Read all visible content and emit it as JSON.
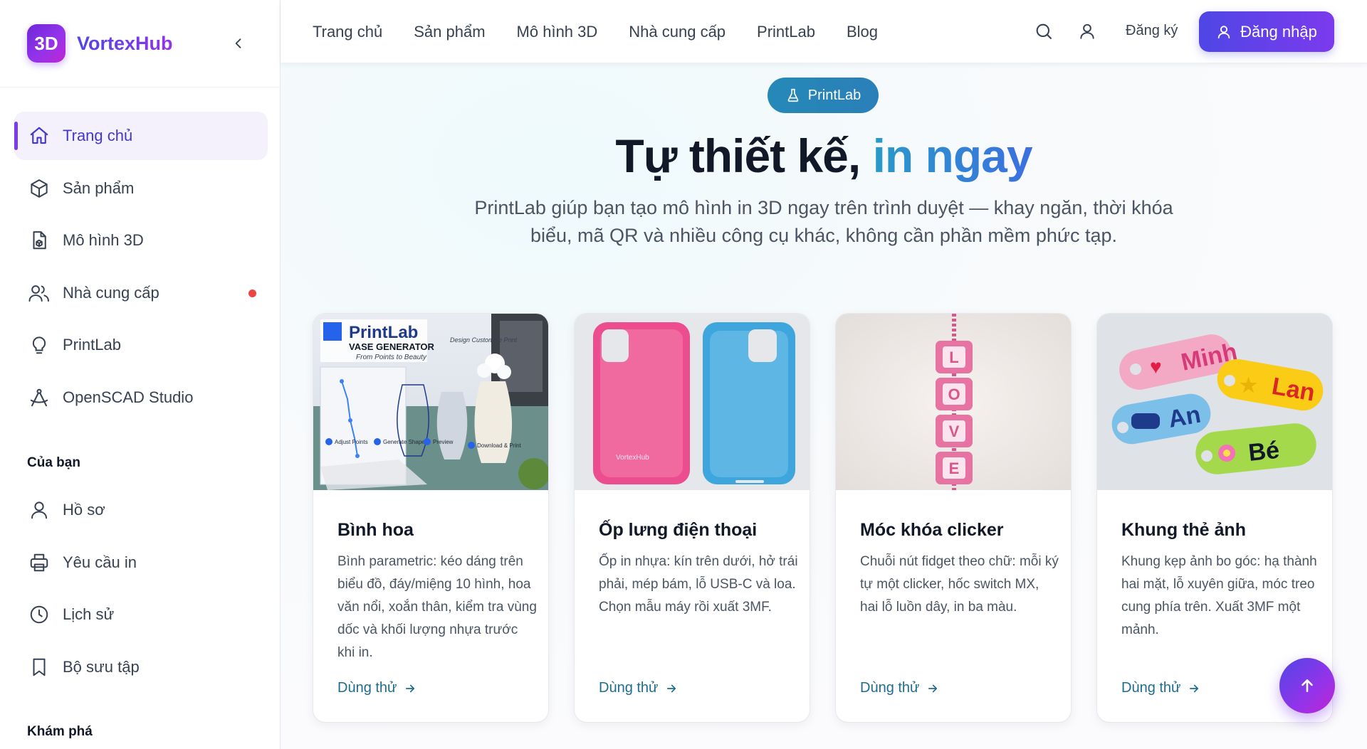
{
  "brand": {
    "logo_text": "3D",
    "name": "VortexHub"
  },
  "sidebar": {
    "items": [
      {
        "label": "Trang chủ",
        "icon": "home-icon",
        "active": true
      },
      {
        "label": "Sản phẩm",
        "icon": "cube-icon"
      },
      {
        "label": "Mô hình 3D",
        "icon": "model-file-icon"
      },
      {
        "label": "Nhà cung cấp",
        "icon": "users-icon",
        "badge": "red-dot"
      },
      {
        "label": "PrintLab",
        "icon": "lightbulb-icon"
      },
      {
        "label": "OpenSCAD Studio",
        "icon": "compass-icon"
      }
    ],
    "section_yours": "Của bạn",
    "yours_items": [
      {
        "label": "Hồ sơ",
        "icon": "user-icon"
      },
      {
        "label": "Yêu cầu in",
        "icon": "printer-icon"
      },
      {
        "label": "Lịch sử",
        "icon": "clock-icon"
      },
      {
        "label": "Bộ sưu tập",
        "icon": "bookmark-icon"
      }
    ],
    "section_explore": "Khám phá"
  },
  "topnav": {
    "links": [
      "Trang chủ",
      "Sản phẩm",
      "Mô hình 3D",
      "Nhà cung cấp",
      "PrintLab",
      "Blog"
    ],
    "register": "Đăng ký",
    "login": "Đăng nhập"
  },
  "hero": {
    "pill": "PrintLab",
    "title_main": "Tự thiết kế, ",
    "title_accent": "in ngay",
    "subtitle": "PrintLab giúp bạn tạo mô hình in 3D ngay trên trình duyệt — khay ngăn, thời khóa biểu, mã QR và nhiều công cụ khác, không cần phần mềm phức tạp."
  },
  "cards": [
    {
      "title": "Bình hoa",
      "desc": "Bình parametric: kéo dáng trên biểu đồ, đáy/miệng 10 hình, hoa văn nổi, xoắn thân, kiểm tra vùng dốc và khối lượng nhựa trước khi in.",
      "cta": "Dùng thử",
      "image": {
        "brand": "PrintLab",
        "heading": "VASE GENERATOR",
        "tagline": "From Points to Beauty",
        "side_note": "Design Customize Print",
        "steps": [
          "Adjust Points",
          "Generate Shape",
          "Preview",
          "Download & Print"
        ]
      }
    },
    {
      "title": "Ốp lưng điện thoại",
      "desc": "Ốp in nhựa: kín trên dưới, hở trái phải, mép bám, lỗ USB-C và loa. Chọn mẫu máy rồi xuất 3MF.",
      "cta": "Dùng thử",
      "image": {
        "case_text": "VortexHub",
        "colors": [
          "#ec4d8e",
          "#3ea6dc"
        ]
      }
    },
    {
      "title": "Móc khóa clicker",
      "desc": "Chuỗi nút fidget theo chữ: mỗi ký tự một clicker, hốc switch MX, hai lỗ luồn dây, in ba màu.",
      "cta": "Dùng thử",
      "image": {
        "letters": [
          "L",
          "O",
          "V",
          "E"
        ]
      }
    },
    {
      "title": "Khung thẻ ảnh",
      "desc": "Khung kẹp ảnh bo góc: hạ thành hai mặt, lỗ xuyên giữa, móc treo cung phía trên. Xuất 3MF một mảnh.",
      "cta": "Dùng thử",
      "image": {
        "tags": [
          "Minh",
          "Lan",
          "An",
          "Bé"
        ]
      }
    }
  ],
  "colors": {
    "accent": "#4f46e5",
    "brand_purple": "#7c3aed",
    "teal_cta": "#1e6c8f",
    "badge_red": "#ef4444"
  }
}
